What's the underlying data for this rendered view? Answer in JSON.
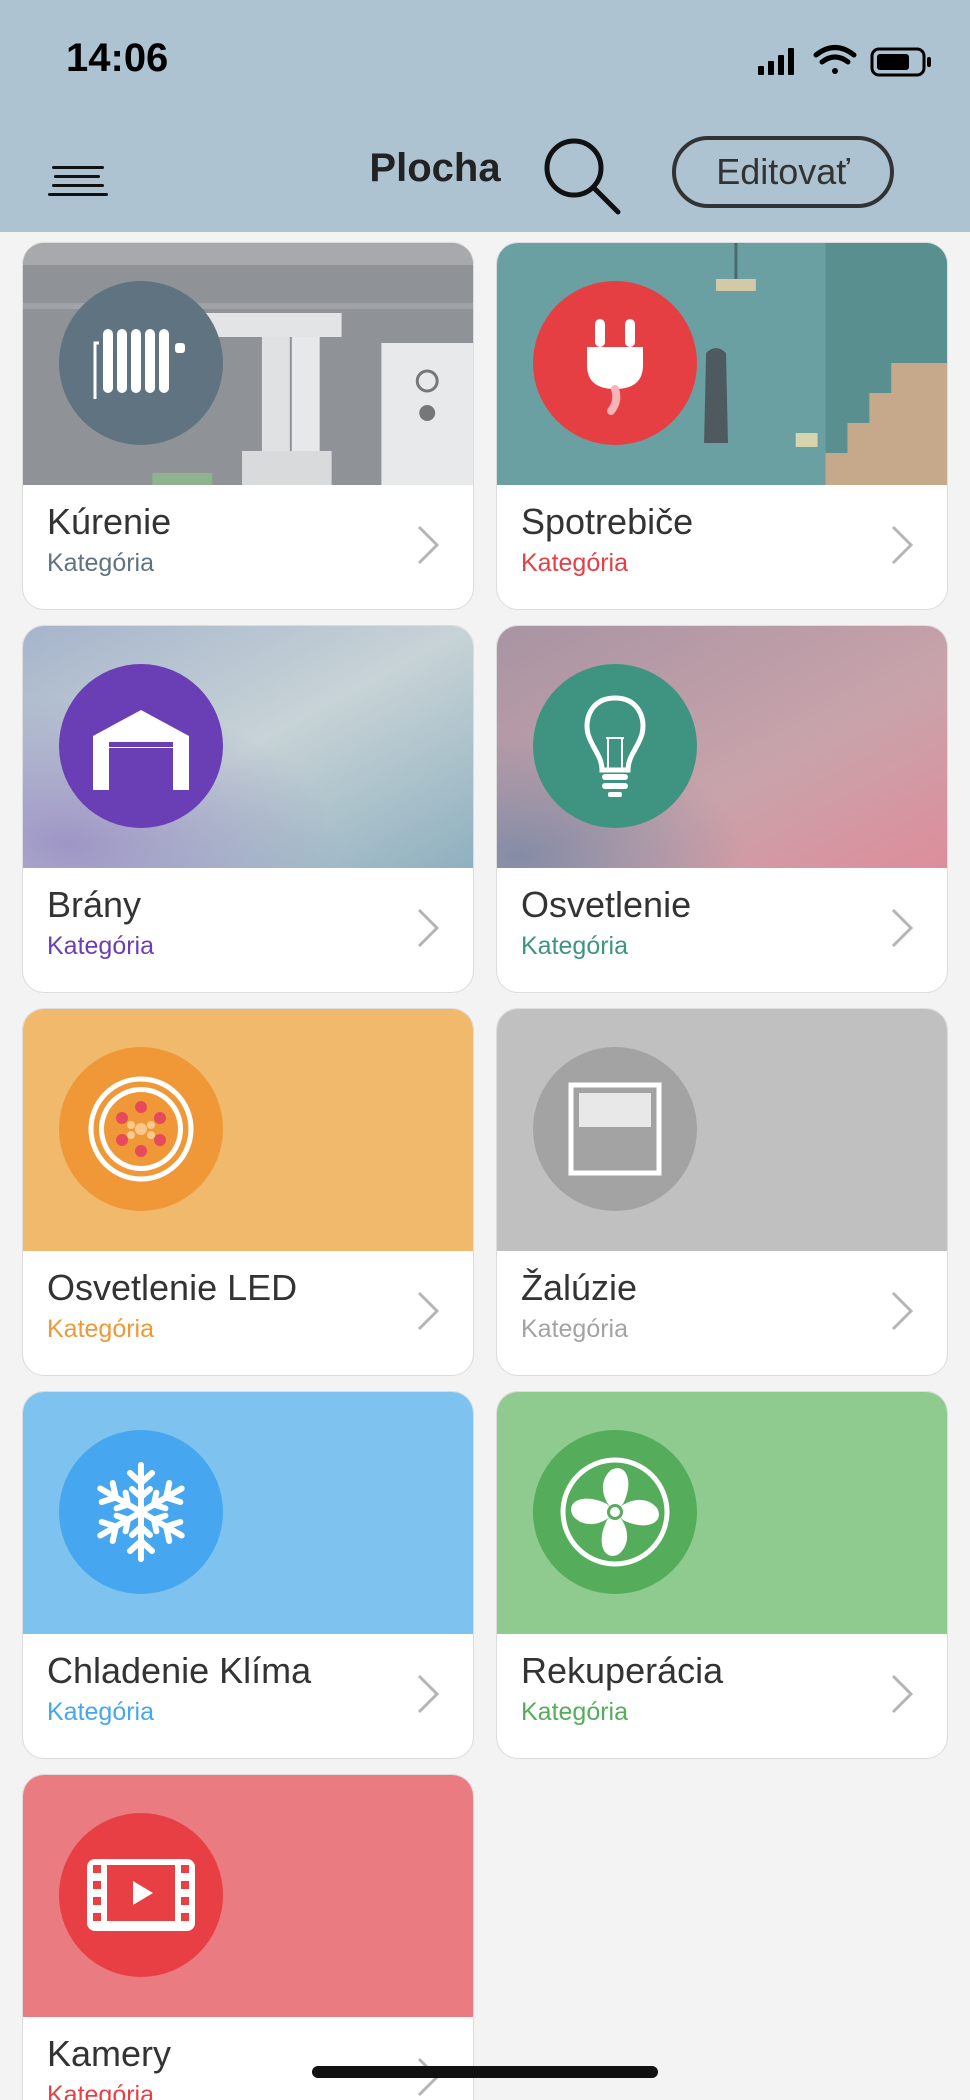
{
  "status_bar": {
    "time": "14:06"
  },
  "header": {
    "title": "Plocha",
    "edit_label": "Editovať"
  },
  "colors": {
    "header_bg": "#adc3d1",
    "kurenie": "#5f7380",
    "spotrebice": "#e53f44",
    "brany": "#6a3fb5",
    "osvetlenie": "#3e9480",
    "led": "#f09837",
    "zaluzie": "#a3a3a3",
    "chladenie": "#46a6ef",
    "rekuperacia": "#55ad5b",
    "kamery": "#e83f44"
  },
  "categories": [
    {
      "title": "Kúrenie",
      "subtitle": "Kategória",
      "icon": "radiator-icon",
      "accent": "#5f7380"
    },
    {
      "title": "Spotrebiče",
      "subtitle": "Kategória",
      "icon": "plug-icon",
      "accent": "#e53f44"
    },
    {
      "title": "Brány",
      "subtitle": "Kategória",
      "icon": "garage-icon",
      "accent": "#6a3fb5"
    },
    {
      "title": "Osvetlenie",
      "subtitle": "Kategória",
      "icon": "bulb-icon",
      "accent": "#3e9480"
    },
    {
      "title": "Osvetlenie LED",
      "subtitle": "Kategória",
      "icon": "led-icon",
      "accent": "#f09837"
    },
    {
      "title": "Žalúzie",
      "subtitle": "Kategória",
      "icon": "blinds-icon",
      "accent": "#a3a3a3"
    },
    {
      "title": "Chladenie Klíma",
      "subtitle": "Kategória",
      "icon": "snowflake-icon",
      "accent": "#46a6ef"
    },
    {
      "title": "Rekuperácia",
      "subtitle": "Kategória",
      "icon": "fan-icon",
      "accent": "#55ad5b"
    },
    {
      "title": "Kamery",
      "subtitle": "Kategória",
      "icon": "video-icon",
      "accent": "#e83f44"
    }
  ]
}
